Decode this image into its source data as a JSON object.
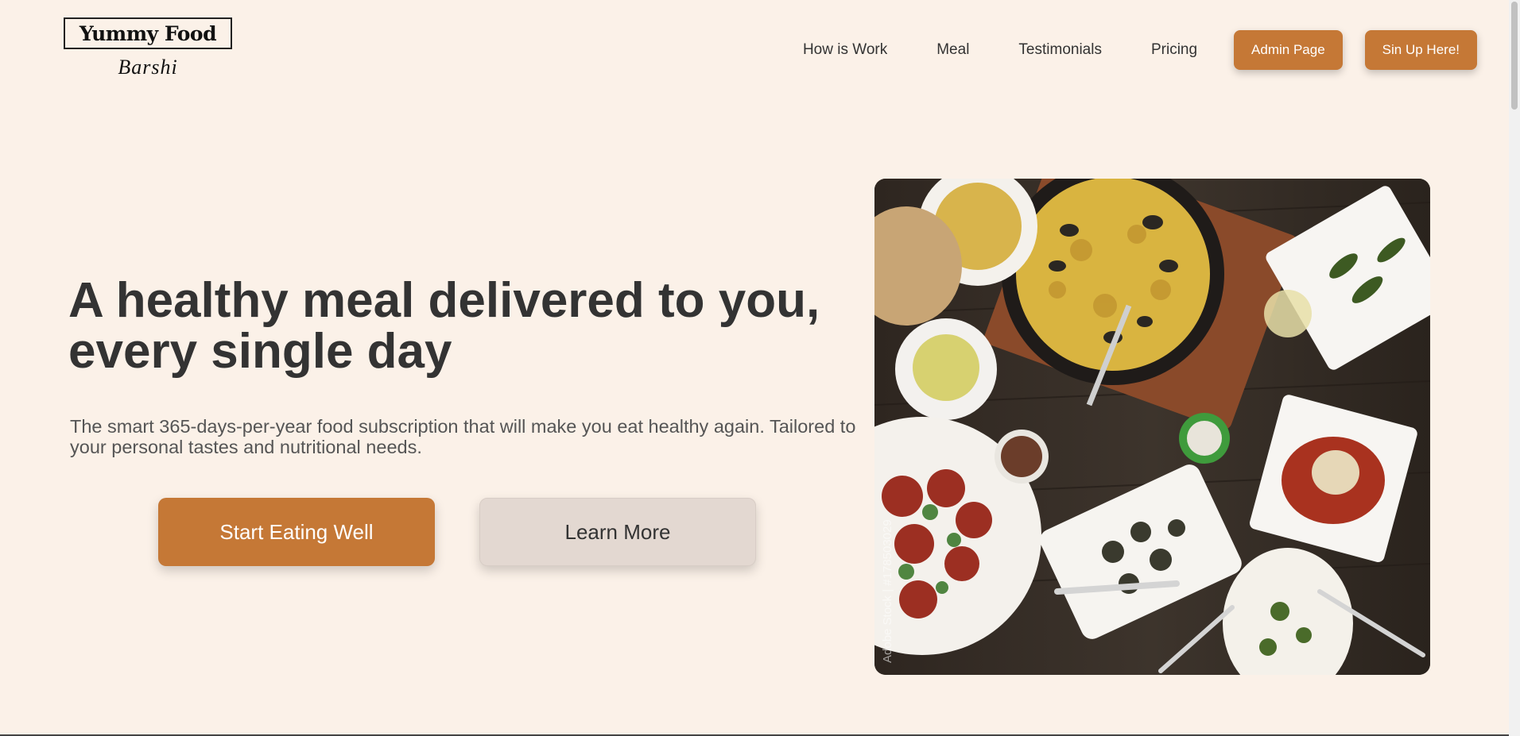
{
  "logo": {
    "title": "Yummy Food",
    "subtitle": "Barshi"
  },
  "nav": {
    "links": [
      "How is Work",
      "Meal",
      "Testimonials",
      "Pricing"
    ],
    "admin_button": "Admin Page",
    "signup_button": "Sin Up Here!"
  },
  "hero": {
    "title": "A healthy meal delivered to you, every single day",
    "text": "The smart 365-days-per-year food subscription that will make you eat healthy again. Tailored to your personal tastes and nutritional needs.",
    "primary_button": "Start Eating Well",
    "secondary_button": "Learn More"
  },
  "image": {
    "watermark": "Adobe Stock | #178503029"
  },
  "colors": {
    "background": "#fbf1e8",
    "accent": "#c57836",
    "secondary_button": "#e3d8d1",
    "text": "#333333"
  }
}
